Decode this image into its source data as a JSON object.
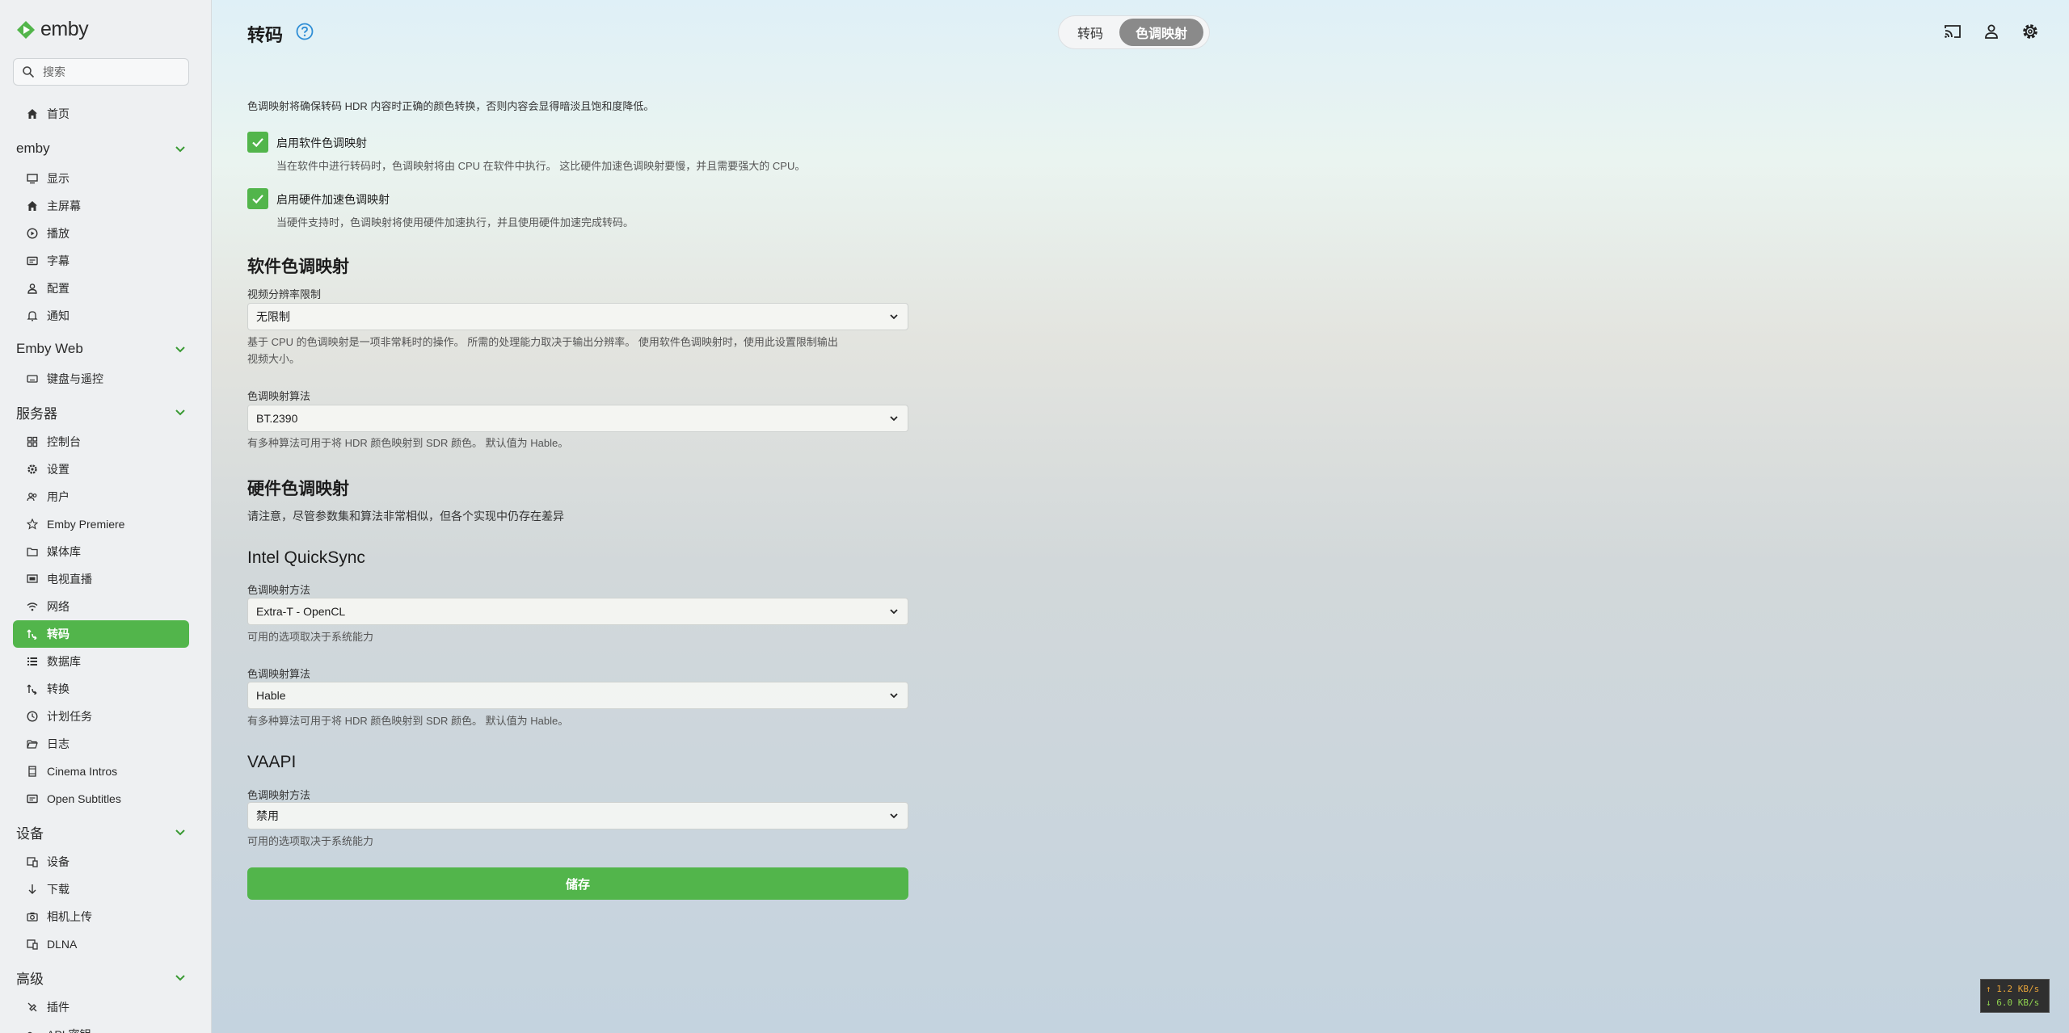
{
  "app": {
    "logo_text": "emby"
  },
  "search": {
    "placeholder": "搜索"
  },
  "sidebar": {
    "home": "首页",
    "sections": [
      {
        "title": "emby",
        "items": [
          "显示",
          "主屏幕",
          "播放",
          "字幕",
          "配置",
          "通知"
        ]
      },
      {
        "title": "Emby Web",
        "items": [
          "键盘与遥控"
        ]
      },
      {
        "title": "服务器",
        "items": [
          "控制台",
          "设置",
          "用户",
          "Emby Premiere",
          "媒体库",
          "电视直播",
          "网络",
          "转码",
          "数据库",
          "转换",
          "计划任务",
          "日志",
          "Cinema Intros",
          "Open Subtitles"
        ]
      },
      {
        "title": "设备",
        "items": [
          "设备",
          "下载",
          "相机上传",
          "DLNA"
        ]
      },
      {
        "title": "高级",
        "items": [
          "插件",
          "API 密钥"
        ]
      }
    ],
    "active_item": "转码"
  },
  "header": {
    "title": "转码",
    "tabs": [
      {
        "label": "转码",
        "active": false
      },
      {
        "label": "色调映射",
        "active": true
      }
    ]
  },
  "main": {
    "intro": "色调映射将确保转码 HDR 内容时正确的颜色转换，否则内容会显得暗淡且饱和度降低。",
    "software_checkbox": {
      "label": "启用软件色调映射",
      "checked": true,
      "description": "当在软件中进行转码时，色调映射将由 CPU 在软件中执行。 这比硬件加速色调映射要慢，并且需要强大的 CPU。"
    },
    "hardware_checkbox": {
      "label": "启用硬件加速色调映射",
      "checked": true,
      "description": "当硬件支持时，色调映射将使用硬件加速执行，并且使用硬件加速完成转码。"
    },
    "software_section": {
      "title": "软件色调映射",
      "resolution": {
        "label": "视频分辨率限制",
        "value": "无限制",
        "help_line1": "基于 CPU 的色调映射是一项非常耗时的操作。 所需的处理能力取决于输出分辨率。 使用软件色调映射时，使用此设置限制输出",
        "help_line2": "视频大小。"
      },
      "algorithm": {
        "label": "色调映射算法",
        "value": "BT.2390",
        "help": "有多种算法可用于将 HDR 颜色映射到 SDR 颜色。 默认值为 Hable。"
      }
    },
    "hardware_section": {
      "title": "硬件色调映射",
      "note": "请注意，尽管参数集和算法非常相似，但各个实现中仍存在差异"
    },
    "intel_section": {
      "title": "Intel QuickSync",
      "method": {
        "label": "色调映射方法",
        "value": "Extra-T - OpenCL",
        "help": "可用的选项取决于系统能力"
      },
      "algorithm": {
        "label": "色调映射算法",
        "value": "Hable",
        "help": "有多种算法可用于将 HDR 颜色映射到 SDR 颜色。 默认值为 Hable。"
      }
    },
    "vaapi_section": {
      "title": "VAAPI",
      "method": {
        "label": "色调映射方法",
        "value": "禁用",
        "help": "可用的选项取决于系统能力"
      }
    },
    "save_label": "储存"
  },
  "network_monitor": {
    "upload": "↑ 1.2 KB/s",
    "download": "↓ 6.0 KB/s"
  },
  "colors": {
    "accent": "#52b54b",
    "tab_active": "#8a8a8a",
    "help_icon": "#2f8ed6"
  }
}
